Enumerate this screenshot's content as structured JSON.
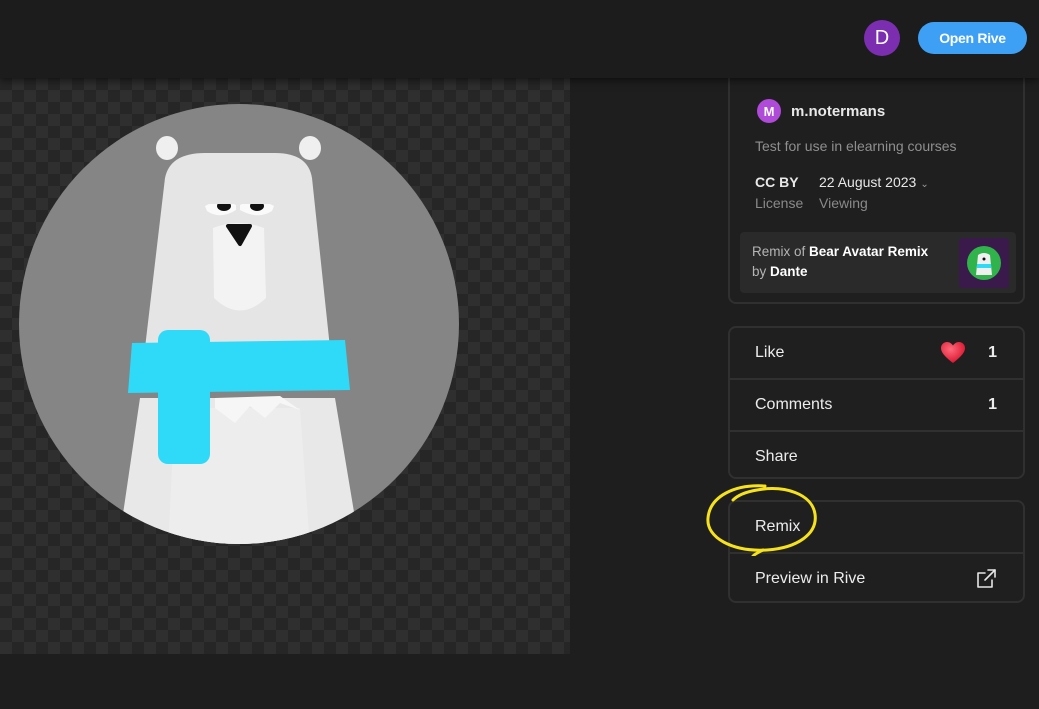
{
  "topbar": {
    "user_initial": "D",
    "open_button_label": "Open Rive"
  },
  "post": {
    "author_initial": "M",
    "author_name": "m.notermans",
    "description": "Test for use in elearning courses",
    "license_value": "CC BY",
    "license_label": "License",
    "date_value": "22 August 2023",
    "viewing_label": "Viewing",
    "remix_prefix": "Remix of",
    "remix_title": "Bear Avatar Remix",
    "remix_by": "by",
    "remix_author": "Dante"
  },
  "actions": {
    "like_label": "Like",
    "like_count": "1",
    "comments_label": "Comments",
    "comments_count": "1",
    "share_label": "Share",
    "remix_label": "Remix",
    "preview_label": "Preview in Rive"
  },
  "colors": {
    "accent_blue": "#3da0f5",
    "user_avatar": "#7b2fb0",
    "author_avatar": "#b04ad8",
    "scarf": "#2fd9f8",
    "highlight": "#f5e21c"
  },
  "icons": {
    "like": "heart-icon",
    "preview": "external-link-icon",
    "date": "chevron-down-icon"
  }
}
